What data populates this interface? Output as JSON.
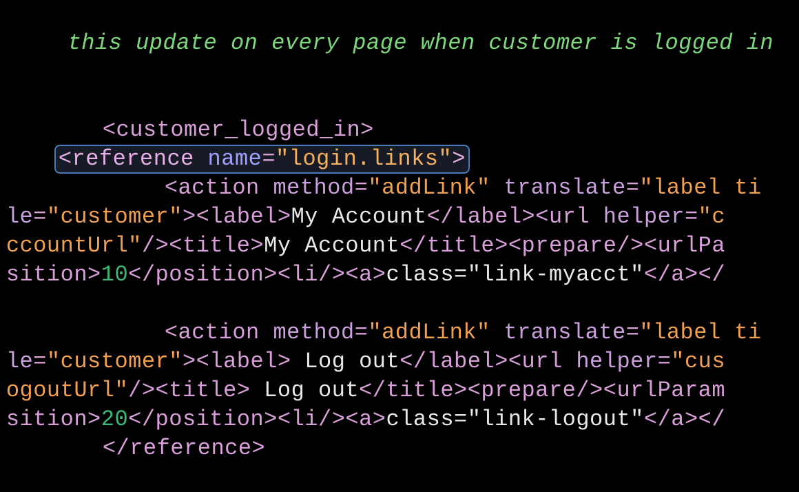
{
  "code": {
    "comment_line": " this update on every page when customer is logged in",
    "line3": {
      "tag_open": "<customer_logged_in>"
    },
    "line4": {
      "tag": "reference",
      "attr1_name": "name",
      "attr1_val": "\"login.links\""
    },
    "line5": {
      "tag": "action",
      "attr1_name": "method",
      "attr1_val": "\"addLink\"",
      "attr2_name": "translate",
      "attr2_val": "\"label ti"
    },
    "line6": {
      "prefix_attr": "le",
      "prefix_val": "\"customer\"",
      "label_open": "<label>",
      "label_text": "My Account",
      "label_close": "</label>",
      "url_open": "<url",
      "url_attr": "helper",
      "url_val": "\"c"
    },
    "line7": {
      "prefix": "ccountUrl\"",
      "slashgt": "/>",
      "title_open": "<title>",
      "title_text": "My Account",
      "title_close": "</title>",
      "prepare": "<prepare/>",
      "urlpa": "<urlPa"
    },
    "line8": {
      "prefix": "sition>",
      "num": "10",
      "close": "</position>",
      "li": "<li/>",
      "a_open": "<a>",
      "a_text": "class=\"link-myacct\"",
      "a_close": "</a>",
      "tail": "</"
    },
    "line10": {
      "tag": "action",
      "attr1_name": "method",
      "attr1_val": "\"addLink\"",
      "attr2_name": "translate",
      "attr2_val": "\"label ti"
    },
    "line11": {
      "prefix_attr": "le",
      "prefix_val": "\"customer\"",
      "label_open": "<label>",
      "label_text": " Log out",
      "label_close": "</label>",
      "url_open": "<url",
      "url_attr": "helper",
      "url_val": "\"cus"
    },
    "line12": {
      "prefix": "ogoutUrl\"",
      "slashgt": "/>",
      "title_open": "<title>",
      "title_text": " Log out",
      "title_close": "</title>",
      "prepare": "<prepare/>",
      "urlparam": "<urlParam"
    },
    "line13": {
      "prefix": "sition>",
      "num": "20",
      "close": "</position>",
      "li": "<li/>",
      "a_open": "<a>",
      "a_text": "class=\"link-logout\"",
      "a_close": "</a>",
      "tail": "</"
    },
    "line14": {
      "close": "</reference>"
    }
  }
}
